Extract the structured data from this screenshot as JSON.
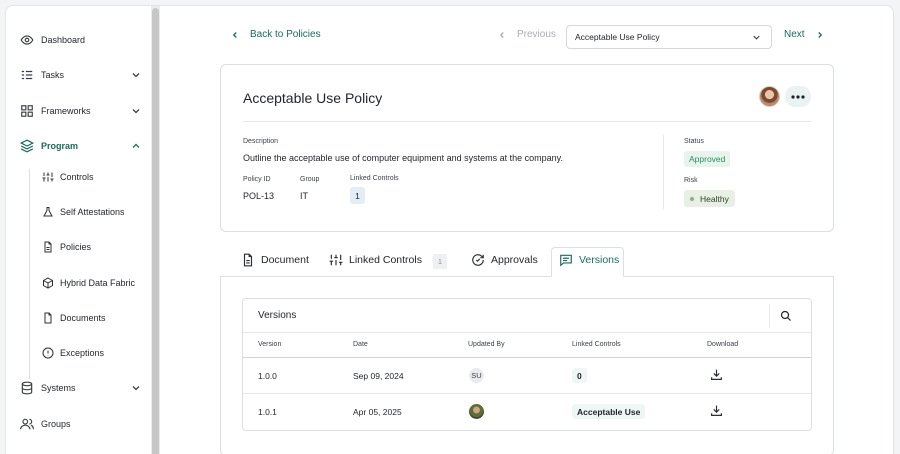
{
  "sidebar": {
    "items": [
      {
        "label": "Dashboard",
        "icon": "eye-icon"
      },
      {
        "label": "Tasks",
        "icon": "tasks-icon"
      },
      {
        "label": "Frameworks",
        "icon": "frameworks-icon"
      },
      {
        "label": "Program",
        "icon": "layers-icon"
      },
      {
        "label": "Systems",
        "icon": "database-icon"
      },
      {
        "label": "Groups",
        "icon": "users-icon"
      }
    ],
    "program_items": [
      {
        "label": "Controls",
        "icon": "sliders-icon"
      },
      {
        "label": "Self Attestations",
        "icon": "flask-icon"
      },
      {
        "label": "Policies",
        "icon": "document-icon"
      },
      {
        "label": "Hybrid Data Fabric",
        "icon": "cube-icon"
      },
      {
        "label": "Documents",
        "icon": "file-icon"
      },
      {
        "label": "Exceptions",
        "icon": "alert-circle-icon"
      }
    ]
  },
  "topbar": {
    "back_label": "Back to Policies",
    "previous_label": "Previous",
    "selected_policy": "Acceptable Use Policy",
    "next_label": "Next"
  },
  "policy": {
    "title": "Acceptable Use Policy",
    "description_label": "Description",
    "description": "Outline the acceptable use of computer equipment and systems at the company.",
    "id_label": "Policy ID",
    "id": "POL-13",
    "group_label": "Group",
    "group": "IT",
    "linked_label": "Linked Controls",
    "linked_count": "1",
    "status_label": "Status",
    "status": "Approved",
    "risk_label": "Risk",
    "risk": "Healthy"
  },
  "tabs": [
    {
      "label": "Document",
      "icon": "document-icon"
    },
    {
      "label": "Linked Controls",
      "icon": "sliders-icon",
      "count": "1"
    },
    {
      "label": "Approvals",
      "icon": "refresh-check-icon"
    },
    {
      "label": "Versions",
      "icon": "message-box-icon"
    }
  ],
  "versions": {
    "title": "Versions",
    "columns": [
      "Version",
      "Date",
      "Updated By",
      "Linked Controls",
      "Download"
    ],
    "rows": [
      {
        "version": "1.0.0",
        "date": "Sep 09, 2024",
        "updated_by": "SU",
        "linked": "0"
      },
      {
        "version": "1.0.1",
        "date": "Apr 05, 2025",
        "updated_by": "",
        "linked": "Acceptable Use"
      }
    ]
  },
  "colors": {
    "accent": "#1b6a5c",
    "approved": "#2e8f5e",
    "healthy_bg": "#e8efe4"
  }
}
